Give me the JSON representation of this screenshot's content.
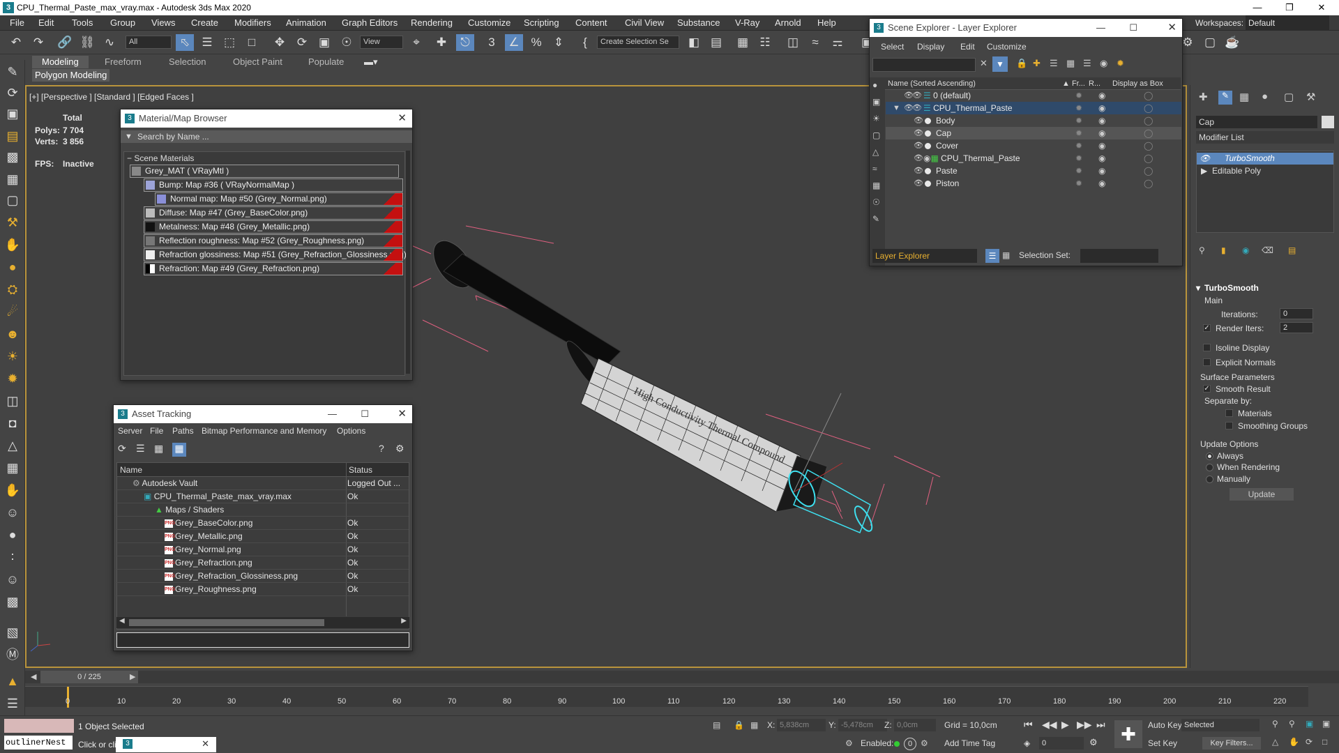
{
  "title_bar": {
    "title": "CPU_Thermal_Paste_max_vray.max - Autodesk 3ds Max 2020",
    "app_icon": "3"
  },
  "menu": [
    "File",
    "Edit",
    "Tools",
    "Group",
    "Views",
    "Create",
    "Modifiers",
    "Animation",
    "Graph Editors",
    "Rendering",
    "Customize",
    "Scripting",
    "Content",
    "Civil View",
    "Substance",
    "V-Ray",
    "Arnold",
    "Help"
  ],
  "toolbar": {
    "filter": "All",
    "view": "View",
    "selection_set": "Create Selection Se"
  },
  "workspace": {
    "label": "Workspaces:",
    "value": "Default"
  },
  "ribbon": {
    "tabs": [
      "Modeling",
      "Freeform",
      "Selection",
      "Object Paint",
      "Populate"
    ],
    "sub": "Polygon Modeling"
  },
  "viewport": {
    "label": "[+] [Perspective ] [Standard ] [Edged Faces ]",
    "stats": {
      "total": "Total",
      "polys_label": "Polys:",
      "polys": "7 704",
      "verts_label": "Verts:",
      "verts": "3 856",
      "fps_label": "FPS:",
      "fps": "Inactive"
    },
    "syringe_text": "High Conductivity Thermal Compound"
  },
  "material_browser": {
    "title": "Material/Map Browser",
    "search": "Search by Name ...",
    "section": "Scene Materials",
    "root": "Grey_MAT  ( VRayMtl )",
    "items": [
      "Bump: Map #36  ( VRayNormalMap )",
      "Normal map: Map #50 (Grey_Normal.png)",
      "Diffuse: Map #47 (Grey_BaseColor.png)",
      "Metalness: Map #48 (Grey_Metallic.png)",
      "Reflection roughness: Map #52 (Grey_Roughness.png)",
      "Refraction glossiness: Map #51 (Grey_Refraction_Glossiness.png)",
      "Refraction: Map #49 (Grey_Refraction.png)"
    ]
  },
  "asset_tracking": {
    "title": "Asset Tracking",
    "menu": [
      "Server",
      "File",
      "Paths",
      "Bitmap Performance and Memory",
      "Options"
    ],
    "col_name": "Name",
    "col_status": "Status",
    "rows": [
      {
        "name": "Autodesk Vault",
        "status": "Logged Out ..."
      },
      {
        "name": "CPU_Thermal_Paste_max_vray.max",
        "status": "Ok"
      },
      {
        "name": "Maps / Shaders",
        "status": ""
      },
      {
        "name": "Grey_BaseColor.png",
        "status": "Ok"
      },
      {
        "name": "Grey_Metallic.png",
        "status": "Ok"
      },
      {
        "name": "Grey_Normal.png",
        "status": "Ok"
      },
      {
        "name": "Grey_Refraction.png",
        "status": "Ok"
      },
      {
        "name": "Grey_Refraction_Glossiness.png",
        "status": "Ok"
      },
      {
        "name": "Grey_Roughness.png",
        "status": "Ok"
      }
    ]
  },
  "scene_explorer": {
    "title": "Scene Explorer - Layer Explorer",
    "menu": [
      "Select",
      "Display",
      "Edit",
      "Customize"
    ],
    "col_name": "Name (Sorted Ascending)",
    "col_fr": "▲ Fr...",
    "col_r": "R...",
    "col_box": "Display as Box",
    "rows": [
      {
        "name": "0 (default)"
      },
      {
        "name": "CPU_Thermal_Paste"
      },
      {
        "name": "Body"
      },
      {
        "name": "Cap"
      },
      {
        "name": "Cover"
      },
      {
        "name": "CPU_Thermal_Paste"
      },
      {
        "name": "Paste"
      },
      {
        "name": "Piston"
      }
    ],
    "footer_explorer": "Layer Explorer",
    "footer_selset": "Selection Set:"
  },
  "command_panel": {
    "object_name": "Cap",
    "modifier_list": "Modifier List",
    "stack": [
      "TurboSmooth",
      "Editable Poly"
    ],
    "rollout": "TurboSmooth",
    "main": "Main",
    "iterations_label": "Iterations:",
    "iterations": "0",
    "render_iters_label": "Render Iters:",
    "render_iters": "2",
    "isoline": "Isoline Display",
    "explicit": "Explicit Normals",
    "surface": "Surface Parameters",
    "smooth_result": "Smooth Result",
    "separate": "Separate by:",
    "materials": "Materials",
    "smoothing": "Smoothing Groups",
    "update_options": "Update Options",
    "always": "Always",
    "when_rendering": "When Rendering",
    "manually": "Manually",
    "update_btn": "Update"
  },
  "timeline": {
    "frame": "0 / 225",
    "ticks": [
      "0",
      "10",
      "20",
      "30",
      "40",
      "50",
      "60",
      "70",
      "80",
      "90",
      "100",
      "110",
      "120",
      "130",
      "140",
      "150",
      "160",
      "170",
      "180",
      "190",
      "200",
      "210",
      "220"
    ]
  },
  "status_bar": {
    "selected": "1 Object Selected",
    "hint": "Click or click",
    "script": "outlinerNest",
    "x_label": "X:",
    "x": "5,838cm",
    "y_label": "Y:",
    "y": "-5,478cm",
    "z_label": "Z:",
    "z": "0,0cm",
    "grid": "Grid = 10,0cm",
    "enabled": "Enabled:",
    "add_time_tag": "Add Time Tag",
    "auto_key": "Auto Key",
    "set_key": "Set Key",
    "key_mode": "Selected",
    "key_filters": "Key Filters...",
    "frame_field": "0"
  }
}
